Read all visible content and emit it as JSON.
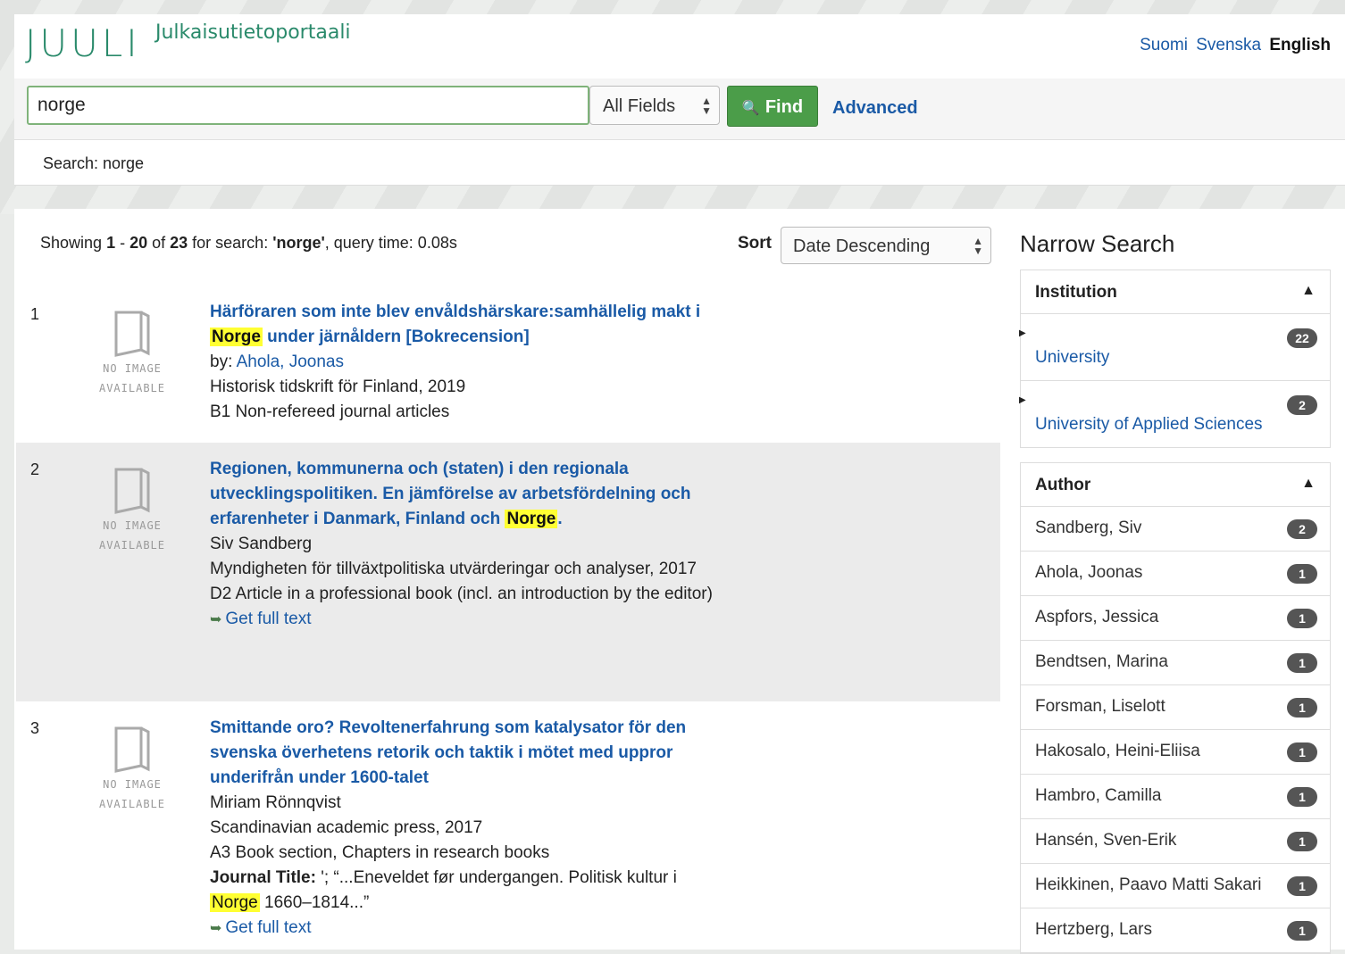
{
  "header": {
    "logo": "JUULI",
    "subtitle": "Julkaisutietoportaali",
    "languages": [
      {
        "label": "Suomi",
        "active": false
      },
      {
        "label": "Svenska",
        "active": false
      },
      {
        "label": "English",
        "active": true
      }
    ]
  },
  "search": {
    "query": "norge",
    "field_select": "All Fields",
    "find_label": "Find",
    "advanced_label": "Advanced",
    "breadcrumb": "Search: norge"
  },
  "results_header": {
    "showing_prefix": "Showing ",
    "range_start": "1",
    "range_sep": " - ",
    "range_end": "20",
    "of": " of ",
    "total": "23",
    "for_search": " for search: ",
    "query_quoted": "'norge'",
    "query_time": ", query time: 0.08s",
    "sort_label": "Sort",
    "sort_value": "Date Descending"
  },
  "results": [
    {
      "num": "1",
      "title_a": "Härföraren som inte blev envåldshärskare:samhällelig makt i ",
      "title_hl": "Norge",
      "title_b": " under järnåldern [Bokrecension]",
      "by_label": "by: ",
      "author": "Ahola, Joonas",
      "source": "Historisk tidskrift för Finland, 2019",
      "type": "B1 Non-refereed journal articles"
    },
    {
      "num": "2",
      "title_a": "Regionen, kommunerna och (staten) i den regionala utvecklingspolitiken. En jämförelse av arbetsfördelning och erfarenheter i Danmark, Finland och ",
      "title_hl": "Norge",
      "title_b": ".",
      "author": "Siv Sandberg",
      "source": "Myndigheten för tillväxtpolitiska utvärderingar och analyser, 2017",
      "type": "D2 Article in a professional book (incl. an introduction by the editor)",
      "fulltext": "Get full text"
    },
    {
      "num": "3",
      "title": "Smittande oro? Revoltenerfahrung som katalysator för den svenska överhetens retorik och taktik i mötet med uppror underifrån under 1600-talet",
      "author": "Miriam Rönnqvist",
      "source": "Scandinavian academic press, 2017",
      "type": "A3 Book section, Chapters in research books",
      "journal_label": "Journal Title:",
      "journal_a": " '; “...Eneveldet før undergangen. Politisk kultur i ",
      "journal_hl": "Norge",
      "journal_b": " 1660–1814...”",
      "fulltext": "Get full text"
    }
  ],
  "no_image": [
    "NO IMAGE",
    "AVAILABLE"
  ],
  "sidebar": {
    "title": "Narrow Search",
    "institution": {
      "heading": "Institution",
      "items": [
        {
          "label": "University",
          "count": "22"
        },
        {
          "label": "University of Applied Sciences",
          "count": "2"
        }
      ]
    },
    "author": {
      "heading": "Author",
      "items": [
        {
          "label": "Sandberg, Siv",
          "count": "2"
        },
        {
          "label": "Ahola, Joonas",
          "count": "1"
        },
        {
          "label": "Aspfors, Jessica",
          "count": "1"
        },
        {
          "label": "Bendtsen, Marina",
          "count": "1"
        },
        {
          "label": "Forsman, Liselott",
          "count": "1"
        },
        {
          "label": "Hakosalo, Heini-Eliisa",
          "count": "1"
        },
        {
          "label": "Hambro, Camilla",
          "count": "1"
        },
        {
          "label": "Hansén, Sven-Erik",
          "count": "1"
        },
        {
          "label": "Heikkinen, Paavo Matti Sakari",
          "count": "1"
        },
        {
          "label": "Hertzberg, Lars",
          "count": "1"
        }
      ]
    }
  }
}
